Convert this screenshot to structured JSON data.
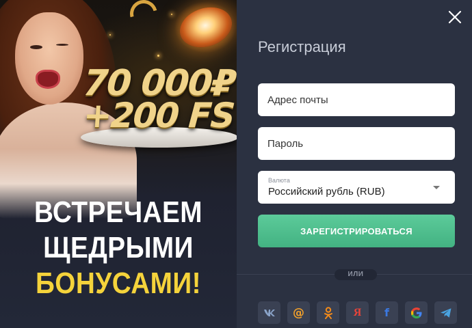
{
  "promo": {
    "prize_amount": "70 000₽",
    "prize_spins": "+200 FS",
    "headline": [
      "ВСТРЕЧАЕМ",
      "ЩЕДРЫМИ",
      "БОНУСАМИ!"
    ]
  },
  "form": {
    "title": "Регистрация",
    "email_placeholder": "Адрес почты",
    "password_placeholder": "Пароль",
    "currency": {
      "label": "Валюта",
      "selected": "Российский рубль (RUB)"
    },
    "submit_label": "ЗАРЕГИСТРИРОВАТЬСЯ",
    "divider_label": "ИЛИ"
  },
  "colors": {
    "panel_bg": "#2b3141",
    "accent_green": "#4cbd8c",
    "headline_yellow": "#f5d33b",
    "social_bg": "#3a4153"
  },
  "socials": [
    {
      "icon": "vk-icon",
      "glyph": "vk",
      "color": "#8aa3c8"
    },
    {
      "icon": "mail-ru-icon",
      "glyph": "@",
      "color": "#f2a02a"
    },
    {
      "icon": "odnoklassniki-icon",
      "glyph": "ok",
      "color": "#f28a1a"
    },
    {
      "icon": "yandex-icon",
      "glyph": "Я",
      "color": "#e8443a"
    },
    {
      "icon": "facebook-icon",
      "glyph": "f",
      "color": "#3b78e0"
    },
    {
      "icon": "google-icon",
      "glyph": "G",
      "color": "#4285f4"
    },
    {
      "icon": "telegram-icon",
      "glyph": "tg",
      "color": "#4aa3e0"
    }
  ]
}
